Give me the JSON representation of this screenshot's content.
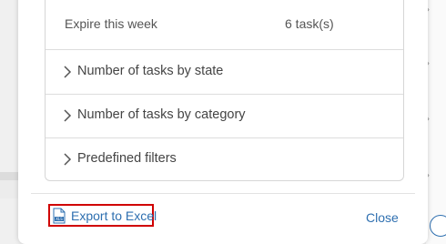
{
  "summary": {
    "expire_label": "Expire this week",
    "expire_value": "6 task(s)"
  },
  "accordion": [
    {
      "label": "Number of tasks by state"
    },
    {
      "label": "Number of tasks by category"
    },
    {
      "label": "Predefined filters"
    }
  ],
  "footer": {
    "export_label": "Export to Excel",
    "close_label": "Close"
  },
  "colors": {
    "link": "#2e6fb0",
    "highlight_border": "#d00000"
  }
}
